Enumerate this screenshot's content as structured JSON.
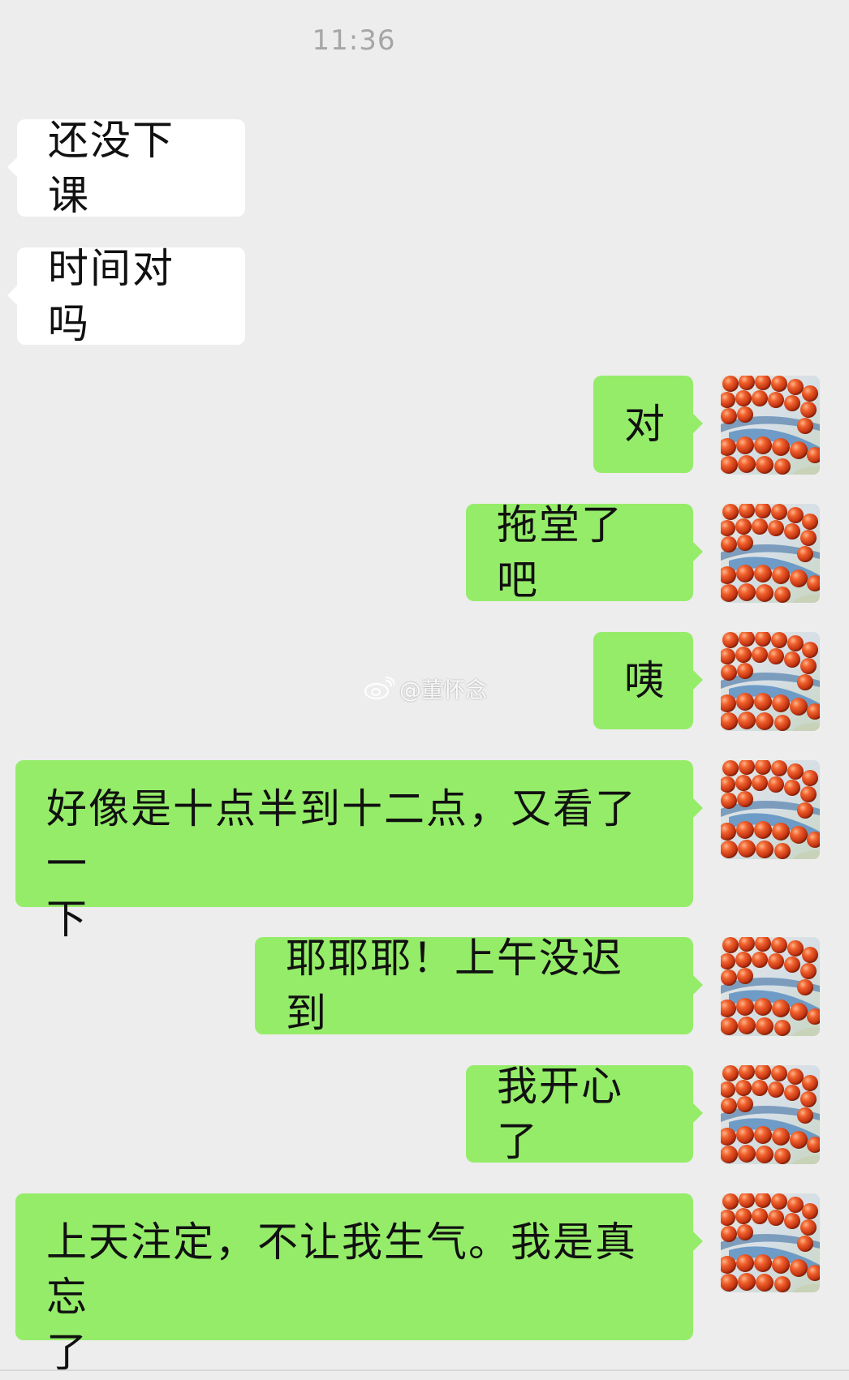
{
  "chat": {
    "timestamp": "11:36",
    "messages": [
      {
        "side": "in",
        "text": "还没下课"
      },
      {
        "side": "in",
        "text": "时间对吗"
      },
      {
        "side": "out",
        "text": "对"
      },
      {
        "side": "out",
        "text": "拖堂了吧"
      },
      {
        "side": "out",
        "text": "咦"
      },
      {
        "side": "out",
        "line1": "好像是十点半到十二点，又看了一",
        "line2": "下"
      },
      {
        "side": "out",
        "text": "耶耶耶！上午没迟到"
      },
      {
        "side": "out",
        "text": "我开心了"
      },
      {
        "side": "out",
        "line1": "上天注定，不让我生气。我是真忘",
        "line2": "了"
      }
    ]
  },
  "watermark": {
    "text": "@董怀念",
    "icon": "weibo-icon"
  },
  "colors": {
    "background": "#ededed",
    "incoming_bubble": "#ffffff",
    "outgoing_bubble": "#95ec69",
    "timestamp": "#a6a6a6"
  },
  "avatar": {
    "icon": "bead-bracelet-avatar"
  }
}
